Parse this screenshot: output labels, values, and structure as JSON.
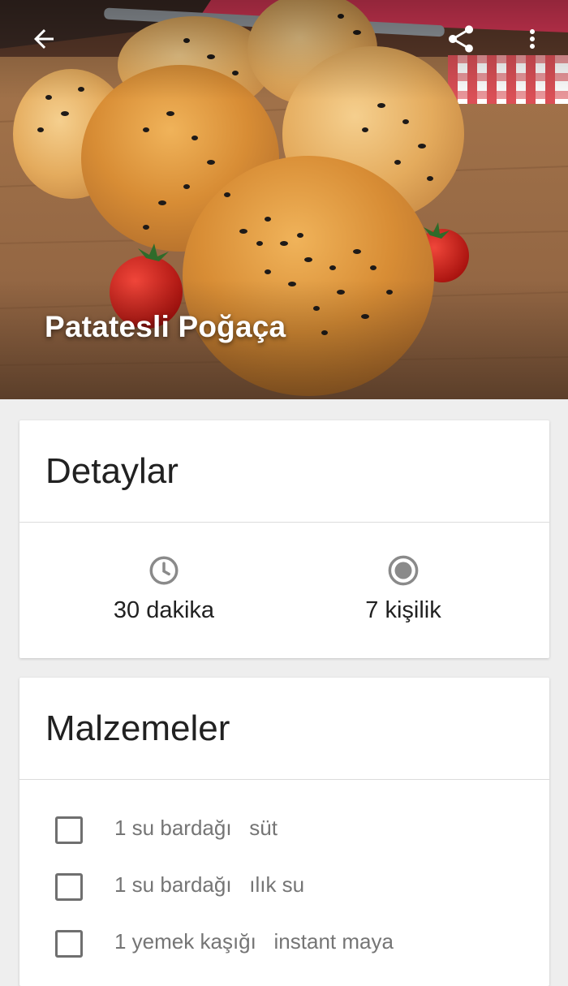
{
  "recipe": {
    "title": "Patatesli Poğaça"
  },
  "topbar": {
    "back_icon": "arrow-back-icon",
    "share_icon": "share-icon",
    "more_icon": "more-vert-icon"
  },
  "details": {
    "header": "Detaylar",
    "time": {
      "icon": "clock-icon",
      "value": "30 dakika"
    },
    "servings": {
      "icon": "radio-dot-icon",
      "value": "7 kişilik"
    }
  },
  "ingredients": {
    "header": "Malzemeler",
    "items": [
      {
        "amount": "1 su bardağı",
        "name": "süt",
        "checked": false
      },
      {
        "amount": "1 su bardağı",
        "name": "ılık su",
        "checked": false
      },
      {
        "amount": "1 yemek kaşığı",
        "name": "instant maya",
        "checked": false
      }
    ]
  },
  "colors": {
    "background": "#eeeeee",
    "card": "#ffffff",
    "text_primary": "#212121",
    "text_secondary": "#757575",
    "icon_gray": "#8a8a8a"
  }
}
